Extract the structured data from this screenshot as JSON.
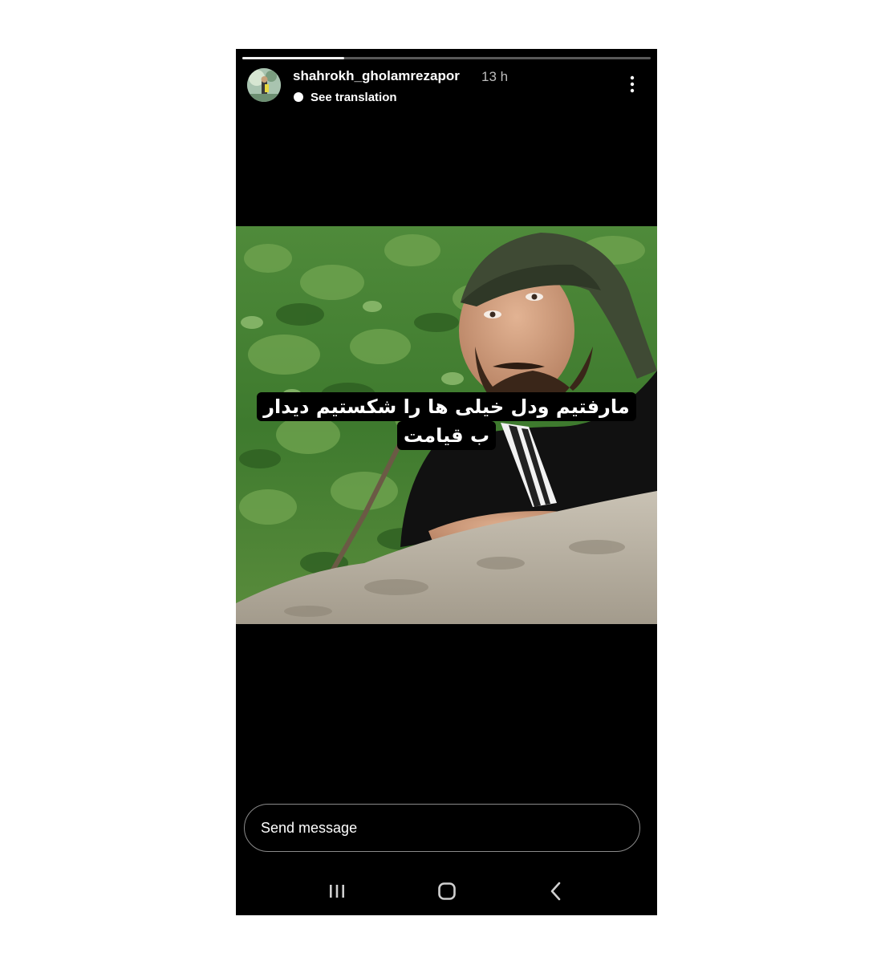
{
  "story": {
    "progress_fraction": 0.25,
    "username": "shahrokh_gholamrezapor",
    "time_ago": "13 h",
    "translate_label": "See translation",
    "caption_line_1": "مارفتیم ودل خیلی ها را شکستیم دیدار",
    "caption_line_2": "ب قیامت"
  },
  "composer": {
    "placeholder": "Send message"
  },
  "icons": {
    "more": "more-vertical-icon",
    "translate": "translate-dot-icon",
    "recents": "recent-apps-icon",
    "home": "home-icon",
    "back": "back-icon"
  },
  "colors": {
    "background": "#000000",
    "text": "#ffffff",
    "muted_text": "#bdbdbd",
    "input_border": "#8a8a8a"
  }
}
